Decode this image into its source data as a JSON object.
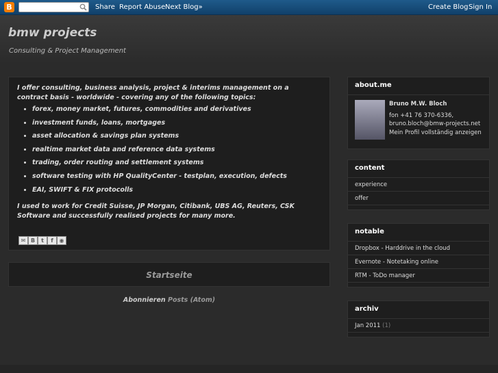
{
  "navbar": {
    "logo_letter": "B",
    "links": [
      "Share",
      "Report Abuse",
      "Next Blog»"
    ],
    "right_links": [
      "Create Blog",
      "Sign In"
    ]
  },
  "header": {
    "title": "bmw projects",
    "description": "Consulting & Project Management"
  },
  "post": {
    "intro": "I offer consulting, business analysis, project & interims management on a contract basis - worldwide - covering any of the following topics:",
    "topics": [
      "forex, money market, futures, commodities and derivatives",
      "investment funds, loans, mortgages",
      "asset allocation & savings plan systems",
      "realtime market data and reference data systems",
      "trading, order routing and settlement systems",
      "software testing with HP QualityCenter - testplan, execution, defects",
      "EAI, SWIFT & FIX protocolls"
    ],
    "outro": "I used to work for Credit Suisse, JP Morgan, Citibank, UBS AG, Reuters, CSK Software and successfully realised projects for many more.",
    "share_icons": [
      "email-icon",
      "blogger-icon",
      "twitter-icon",
      "facebook-icon",
      "buzz-icon"
    ]
  },
  "startseite": "Startseite",
  "subscribe": {
    "label": "Abonnieren",
    "link": "Posts (Atom)"
  },
  "sidebar": {
    "about": {
      "heading": "about.me",
      "name": "Bruno M.W. Bloch",
      "phone": "fon +41 76 370-6336,",
      "email": "bruno.bloch@bmw-projects.net",
      "profile_link": "Mein Profil vollständig anzeigen"
    },
    "content": {
      "heading": "content",
      "items": [
        "experience",
        "offer"
      ]
    },
    "notable": {
      "heading": "notable",
      "items": [
        "Dropbox - Harddrive in the cloud",
        "Evernote - Notetaking online",
        "RTM - ToDo manager"
      ]
    },
    "archiv": {
      "heading": "archiv",
      "month": "Jan 2011",
      "count": "(1)"
    }
  }
}
